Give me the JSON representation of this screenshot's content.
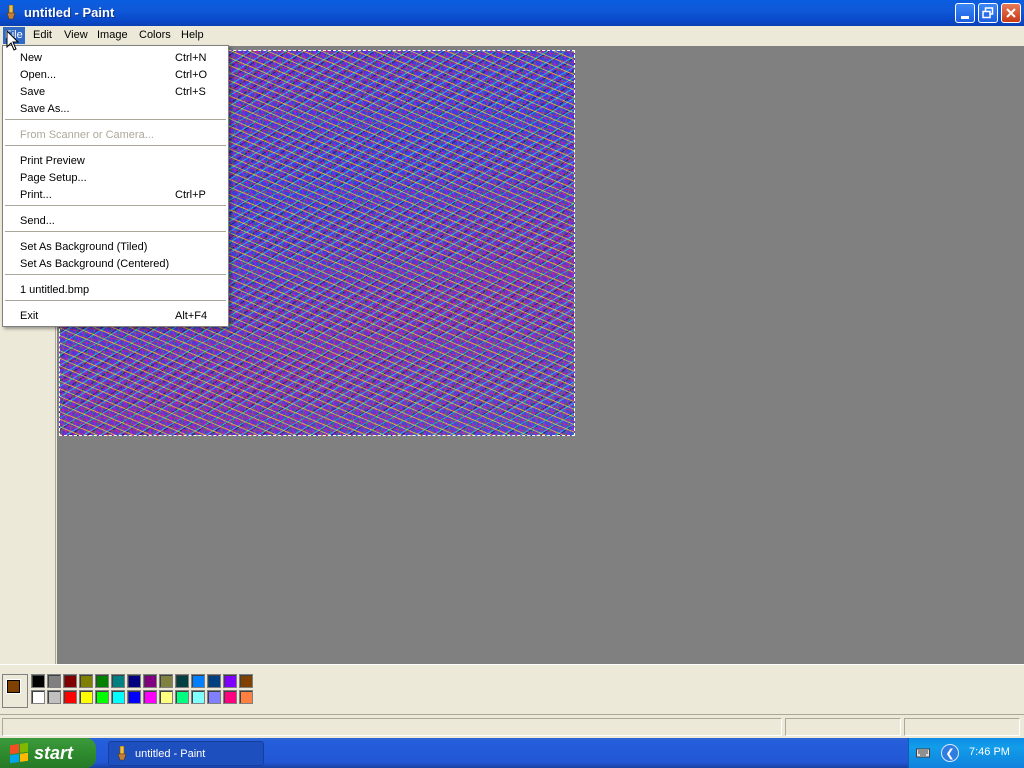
{
  "window": {
    "title": "untitled - Paint"
  },
  "menubar": {
    "items": [
      "File",
      "Edit",
      "View",
      "Image",
      "Colors",
      "Help"
    ]
  },
  "file_menu": {
    "items": [
      {
        "label": "New",
        "shortcut": "Ctrl+N",
        "enabled": true
      },
      {
        "label": "Open...",
        "shortcut": "Ctrl+O",
        "enabled": true
      },
      {
        "label": "Save",
        "shortcut": "Ctrl+S",
        "enabled": true
      },
      {
        "label": "Save As...",
        "shortcut": "",
        "enabled": true
      },
      {
        "label": "From Scanner or Camera...",
        "shortcut": "",
        "enabled": false
      },
      {
        "label": "Print Preview",
        "shortcut": "",
        "enabled": true
      },
      {
        "label": "Page Setup...",
        "shortcut": "",
        "enabled": true
      },
      {
        "label": "Print...",
        "shortcut": "Ctrl+P",
        "enabled": true
      },
      {
        "label": "Send...",
        "shortcut": "",
        "enabled": true
      },
      {
        "label": "Set As Background (Tiled)",
        "shortcut": "",
        "enabled": true
      },
      {
        "label": "Set As Background (Centered)",
        "shortcut": "",
        "enabled": true
      },
      {
        "label": "1 untitled.bmp",
        "shortcut": "",
        "enabled": true
      },
      {
        "label": "Exit",
        "shortcut": "Alt+F4",
        "enabled": true
      }
    ]
  },
  "palette": {
    "foreground": "#804000",
    "background": "#ffffff",
    "top_row": [
      "#000000",
      "#808080",
      "#800000",
      "#808000",
      "#008000",
      "#008080",
      "#000080",
      "#800080",
      "#808040",
      "#004040",
      "#0080ff",
      "#004080",
      "#8000ff",
      "#804000"
    ],
    "bottom_row": [
      "#ffffff",
      "#c0c0c0",
      "#ff0000",
      "#ffff00",
      "#00ff00",
      "#00ffff",
      "#0000ff",
      "#ff00ff",
      "#ffff80",
      "#00ff80",
      "#80ffff",
      "#8080ff",
      "#ff0080",
      "#ff8040"
    ]
  },
  "taskbar": {
    "start_label": "start",
    "task_label": "untitled - Paint",
    "clock": "7:46 PM"
  }
}
